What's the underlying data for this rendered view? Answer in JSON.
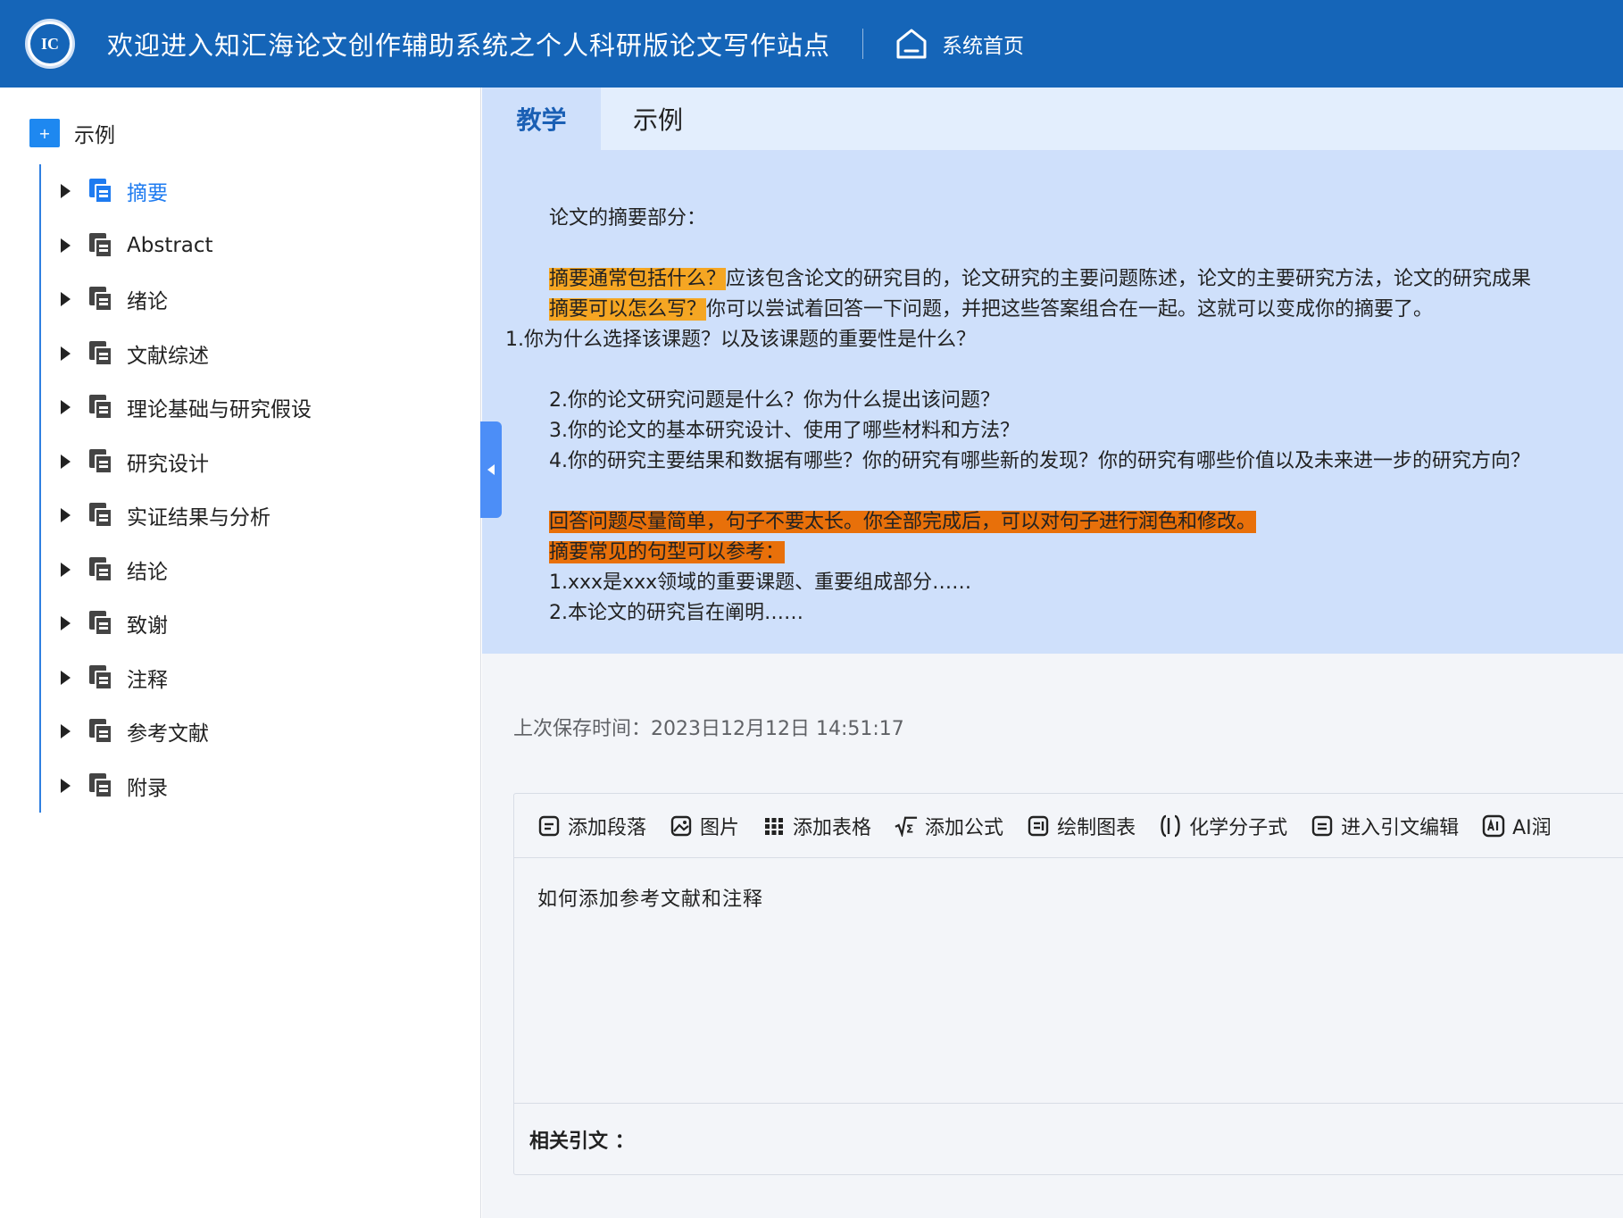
{
  "header": {
    "logo_text": "IC",
    "title": "欢迎进入知汇海论文创作辅助系统之个人科研版论文写作站点",
    "home_label": "系统首页"
  },
  "sidebar": {
    "root": {
      "label": "示例",
      "expand_symbol": "+"
    },
    "items": [
      {
        "label": "摘要",
        "active": true
      },
      {
        "label": "Abstract"
      },
      {
        "label": "绪论"
      },
      {
        "label": "文献综述"
      },
      {
        "label": "理论基础与研究假设"
      },
      {
        "label": "研究设计"
      },
      {
        "label": "实证结果与分析"
      },
      {
        "label": "结论"
      },
      {
        "label": "致谢"
      },
      {
        "label": "注释"
      },
      {
        "label": "参考文献"
      },
      {
        "label": "附录"
      }
    ]
  },
  "tabs": [
    {
      "label": "教学",
      "active": true
    },
    {
      "label": "示例"
    }
  ],
  "guide": {
    "heading": "论文的摘要部分：",
    "q1_hl": "摘要通常包括什么？",
    "q1_text": "应该包含论文的研究目的，论文研究的主要问题陈述，论文的主要研究方法，论文的研究成果",
    "q2_hl": "摘要可以怎么写？",
    "q2_text": "你可以尝试着回答一下问题，并把这些答案组合在一起。这就可以变成你的摘要了。",
    "item1": "1.你为什么选择该课题？以及该课题的重要性是什么？",
    "item2": "2.你的论文研究问题是什么？你为什么提出该问题？",
    "item3": "3.你的论文的基本研究设计、使用了哪些材料和方法？",
    "item4": "4.你的研究主要结果和数据有哪些？你的研究有哪些新的发现？你的研究有哪些价值以及未来进一步的研究方向？",
    "tip_hl": "回答问题尽量简单，句子不要太长。你全部完成后，可以对句子进行润色和修改。",
    "pattern_hl": "摘要常见的句型可以参考：",
    "pattern1": "1.xxx是xxx领域的重要课题、重要组成部分……",
    "pattern2": "2.本论文的研究旨在阐明……"
  },
  "save_time": "上次保存时间：2023日12月12日 14:51:17",
  "toolbar": {
    "add_paragraph": "添加段落",
    "image": "图片",
    "add_table": "添加表格",
    "add_formula": "添加公式",
    "draw_chart": "绘制图表",
    "chem_formula": "化学分子式",
    "citation_edit": "进入引文编辑",
    "ai_polish": "AI润"
  },
  "editor": {
    "content": "如何添加参考文献和注释",
    "citation_label": "相关引文 ："
  },
  "colors": {
    "header_bg": "#1565b8",
    "accent": "#1e7bf0",
    "guide_bg": "#cfe0fb",
    "highlight_orange": "#f5a623",
    "highlight_deep_orange": "#e8700a",
    "heading_red": "#e02020"
  }
}
